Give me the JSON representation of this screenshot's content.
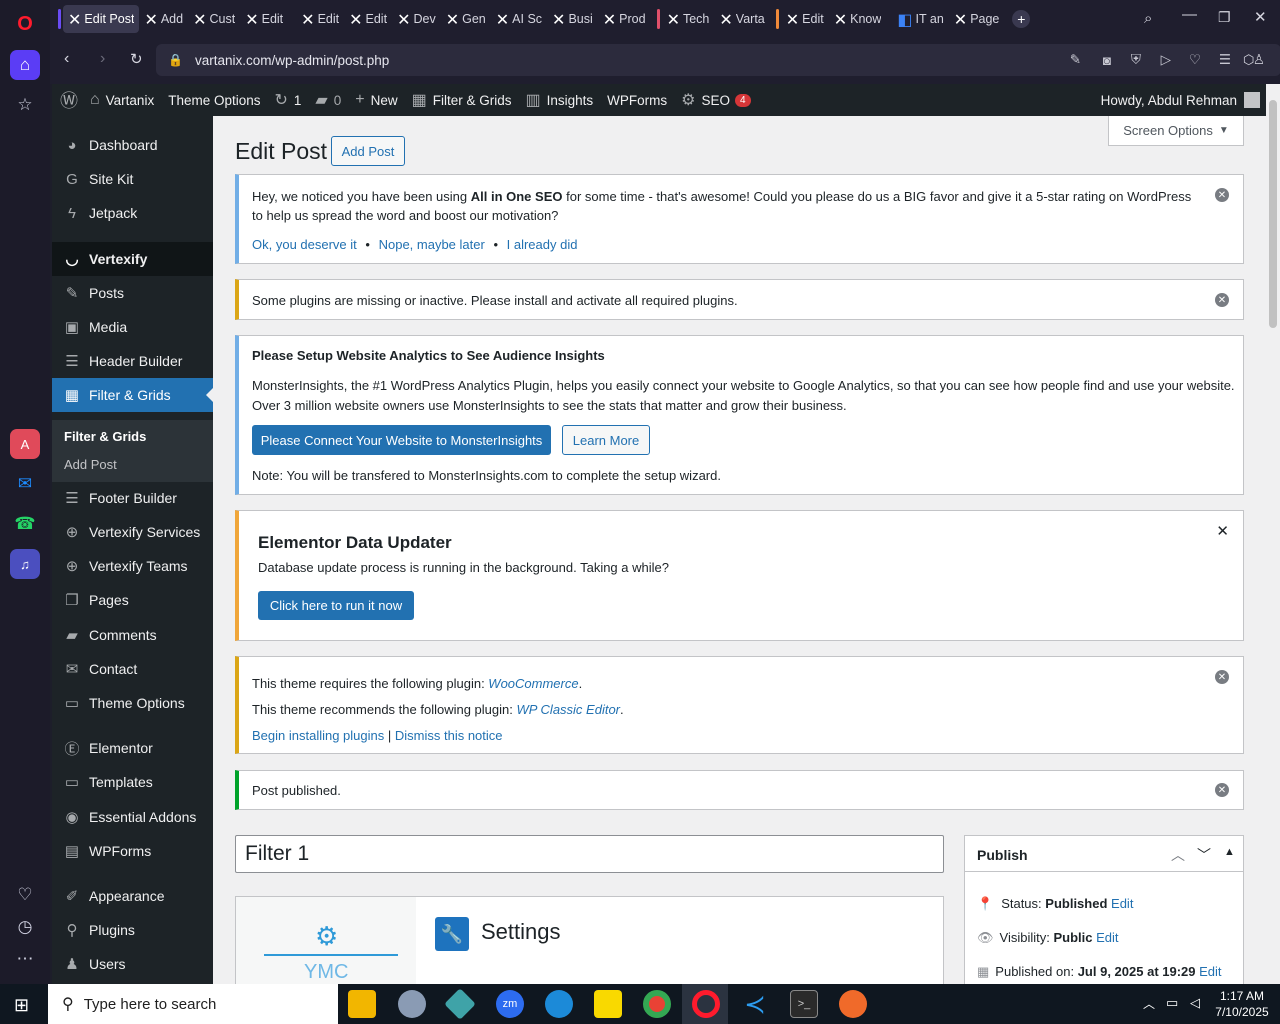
{
  "browser": {
    "tabs": [
      "Edit Post",
      "Add",
      "Cust",
      "Edit",
      "Edit",
      "Edit",
      "Dev",
      "Gen",
      "AI Sc",
      "Busi",
      "Prod",
      "Tech",
      "Varta",
      "Edit",
      "Know",
      "IT an",
      "Page"
    ],
    "url": "vartanix.com/wp-admin/post.php"
  },
  "adminbar": {
    "site": "Vartanix",
    "theme_options": "Theme Options",
    "updates": "1",
    "comments": "0",
    "new": "New",
    "filter_grids": "Filter & Grids",
    "insights": "Insights",
    "wpforms": "WPForms",
    "seo": "SEO",
    "seo_count": "4",
    "howdy": "Howdy, Abdul Rehman"
  },
  "menu": {
    "items": [
      "Dashboard",
      "Site Kit",
      "Jetpack",
      "Vertexify",
      "Posts",
      "Media",
      "Header Builder",
      "Filter & Grids",
      "Footer Builder",
      "Vertexify Services",
      "Vertexify Teams",
      "Pages",
      "Comments",
      "Contact",
      "Theme Options",
      "Elementor",
      "Templates",
      "Essential Addons",
      "WPForms",
      "Appearance",
      "Plugins",
      "Users"
    ],
    "sub": [
      "Filter & Grids",
      "Add Post"
    ]
  },
  "page": {
    "title": "Edit Post",
    "add_post": "Add Post",
    "screen_options": "Screen Options"
  },
  "notices": {
    "aioseo_pre": "Hey, we noticed you have been using ",
    "aioseo_bold": "All in One SEO",
    "aioseo_post": " for some time - that's awesome! Could you please do us a BIG favor and give it a 5-star rating on WordPress to help us spread the word and boost our motivation?",
    "aioseo_l1": "Ok, you deserve it",
    "aioseo_l2": "Nope, maybe later",
    "aioseo_l3": "I already did",
    "plugins_missing": "Some plugins are missing or inactive. Please install and activate all required plugins.",
    "mi_title": "Please Setup Website Analytics to See Audience Insights",
    "mi_text": "MonsterInsights, the #1 WordPress Analytics Plugin, helps you easily connect your website to Google Analytics, so that you can see how people find and use your website. Over 3 million website owners use MonsterInsights to see the stats that matter and grow their business.",
    "mi_connect": "Please Connect Your Website to MonsterInsights",
    "mi_learn": "Learn More",
    "mi_note": "Note: You will be transfered to MonsterInsights.com to complete the setup wizard.",
    "el_title": "Elementor Data Updater",
    "el_text": "Database update process is running in the background. Taking a while?",
    "el_btn": "Click here to run it now",
    "theme_req_pre": "This theme requires the following plugin: ",
    "theme_req_plugin": "WooCommerce",
    "theme_rec_pre": "This theme recommends the following plugin: ",
    "theme_rec_plugin": "WP Classic Editor",
    "begin_install": "Begin installing plugins",
    "dismiss_notice": "Dismiss this notice",
    "published": "Post published."
  },
  "editor": {
    "title_value": "Filter 1",
    "settings": "Settings",
    "logo_text": "YMC"
  },
  "publish": {
    "heading": "Publish",
    "status_label": "Status:",
    "status_value": "Published",
    "visibility_label": "Visibility:",
    "visibility_value": "Public",
    "published_on_label": "Published on:",
    "published_on_value": "Jul 9, 2025 at 19:29",
    "edit": "Edit"
  },
  "taskbar": {
    "search_placeholder": "Type here to search",
    "time": "1:17 AM",
    "date": "7/10/2025"
  },
  "colors": {
    "wp_blue": "#2271b1",
    "adminbar": "#1d2327",
    "warn": "#dba617",
    "success": "#00a32a"
  }
}
